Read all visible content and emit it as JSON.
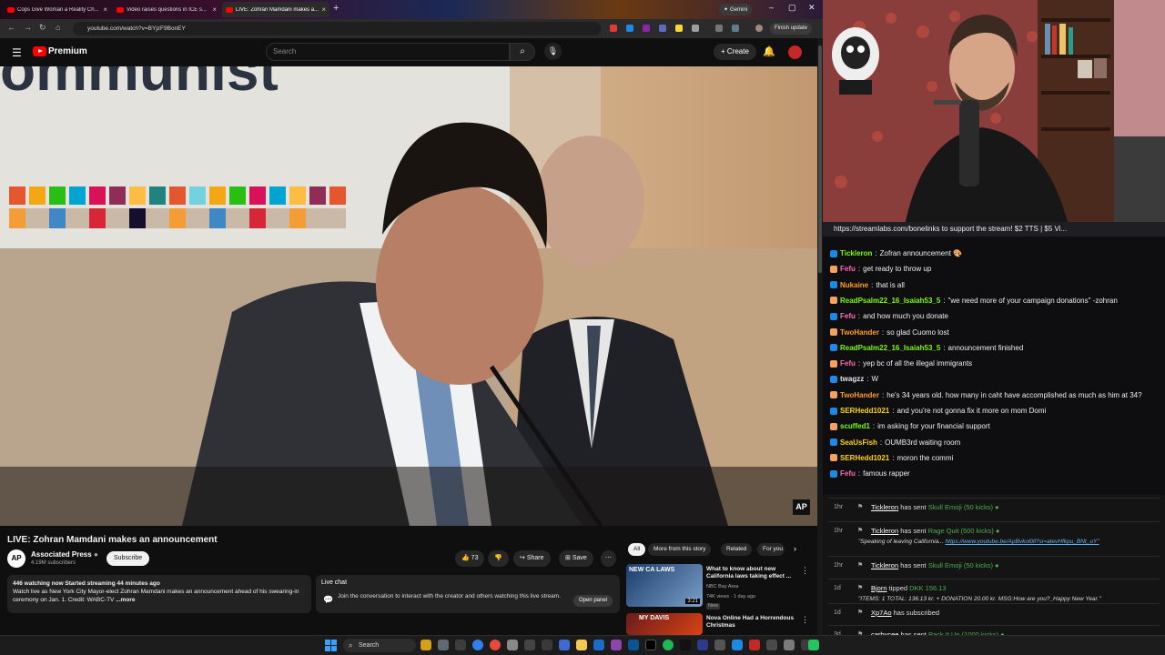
{
  "browser": {
    "tabs": [
      {
        "label": "Cops Give Woman a Reality Ch...",
        "active": false
      },
      {
        "label": "Video raises questions in ICE s...",
        "active": false
      },
      {
        "label": "LIVE: Zohran Mamdani makes a...",
        "active": true
      }
    ],
    "gemini_label": "Gemini",
    "url": "youtube.com/watch?v=BYjzF9BonEY",
    "finish_update": "Finish update"
  },
  "youtube": {
    "brand": "Premium",
    "search_placeholder": "Search",
    "create_label": "Create",
    "video_title": "LIVE: Zohran Mamdani makes an announcement",
    "channel_name": "Associated Press",
    "channel_subs": "4.19M subscribers",
    "subscribe_label": "Subscribe",
    "likes": "73",
    "share_label": "Share",
    "save_label": "Save",
    "ap_watermark": "AP",
    "description": {
      "stats": "446 watching now  Started streaming 44 minutes ago",
      "text": "Watch live as New York City Mayor-elect Zohran Mamdani makes an announcement ahead of his swearing-in ceremony on Jan. 1. Credit: WABC-TV",
      "more": "...more"
    },
    "live_chat": {
      "title": "Live chat",
      "text": "Join the conversation to interact with the creator and others watching this live stream.",
      "open_label": "Open panel"
    },
    "chips": [
      "All",
      "More from this story",
      "Related",
      "For you"
    ],
    "recommendations": [
      {
        "title": "What to know about new California laws taking effect ...",
        "channel": "NBC Bay Area",
        "meta": "74K views · 1 day ago",
        "badge": "New",
        "thumb_text": "NEW CA LAWS",
        "duration": "3:21"
      },
      {
        "title": "Nova Online Had a Horrendous Christmas",
        "channel": "",
        "meta": "",
        "badge": "",
        "thumb_text": "MY DAVIS",
        "duration": ""
      }
    ]
  },
  "stream": {
    "donation_bar": "https://streamlabs.com/bonelinks to support the stream! $2 TTS | $5 Vi...",
    "chat": [
      {
        "user": "Tickleron",
        "color": "#7cfc00",
        "message": "Zofran announcement 🎨"
      },
      {
        "user": "Fefu",
        "color": "#ff69b4",
        "message": "get ready to throw up"
      },
      {
        "user": "Nukaine",
        "color": "#ff9f1c",
        "message": "that is all"
      },
      {
        "user": "ReadPsalm22_16_Isaiah53_5",
        "color": "#7cfc00",
        "message": "\"we need more of your campaign donations\" -zohran"
      },
      {
        "user": "Fefu",
        "color": "#ff69b4",
        "message": "and how much you donate"
      },
      {
        "user": "TwoHander",
        "color": "#ff9f1c",
        "message": "so glad Cuomo lost"
      },
      {
        "user": "ReadPsalm22_16_Isaiah53_5",
        "color": "#7cfc00",
        "message": "announcement finished"
      },
      {
        "user": "Fefu",
        "color": "#ff69b4",
        "message": "yep bc of all the illegal immigrants"
      },
      {
        "user": "twagzz",
        "color": "#e6e6e6",
        "message": "W"
      },
      {
        "user": "TwoHander",
        "color": "#ff9f1c",
        "message": "he's 34 years old. how many in caht have accomplished as much as him at 34?"
      },
      {
        "user": "SERHedd1021",
        "color": "#ffd700",
        "message": "and you're not gonna fix it more on mom Domi"
      },
      {
        "user": "scuffed1",
        "color": "#7cfc00",
        "message": "im asking for your financial support"
      },
      {
        "user": "SeaUsFish",
        "color": "#ffd700",
        "message": "OUMB3rd waiting room"
      },
      {
        "user": "SERHedd1021",
        "color": "#ffd700",
        "message": "moron the commi"
      },
      {
        "user": "Fefu",
        "color": "#ff69b4",
        "message": "famous rapper"
      }
    ],
    "alerts": [
      {
        "time": "1hr",
        "user": "Tickleron",
        "action": "has sent",
        "item": "Skull Emoji (50 kicks)",
        "sub": ""
      },
      {
        "time": "1hr",
        "user": "Tickleron",
        "action": "has sent",
        "item": "Rage Quit (500 kicks)",
        "sub": "\"Speaking of leaving California...",
        "sub_link": "https://www.youtube.be/ApBvkol0ll?si=atevHfkpu_BNt_uY\""
      },
      {
        "time": "1hr",
        "user": "Tickleron",
        "action": "has sent",
        "item": "Skull Emoji (50 kicks)",
        "sub": ""
      },
      {
        "time": "1d",
        "user": "Bjorn",
        "action": "tipped",
        "item": "DKK 156.13",
        "sub": "\"ITEMS: 1 TOTAL: 136.13 kr. + DONATION 20.00 kr. MSG:How are you?_Happy New Year.\""
      },
      {
        "time": "1d",
        "user": "Xp7Ao",
        "action": "has subscribed",
        "item": "",
        "sub": ""
      },
      {
        "time": "3d",
        "user": "carbycee",
        "action": "has sent",
        "item": "Pack It Up (1000 kicks)",
        "sub": ""
      }
    ]
  },
  "taskbar": {
    "search_label": "Search"
  }
}
